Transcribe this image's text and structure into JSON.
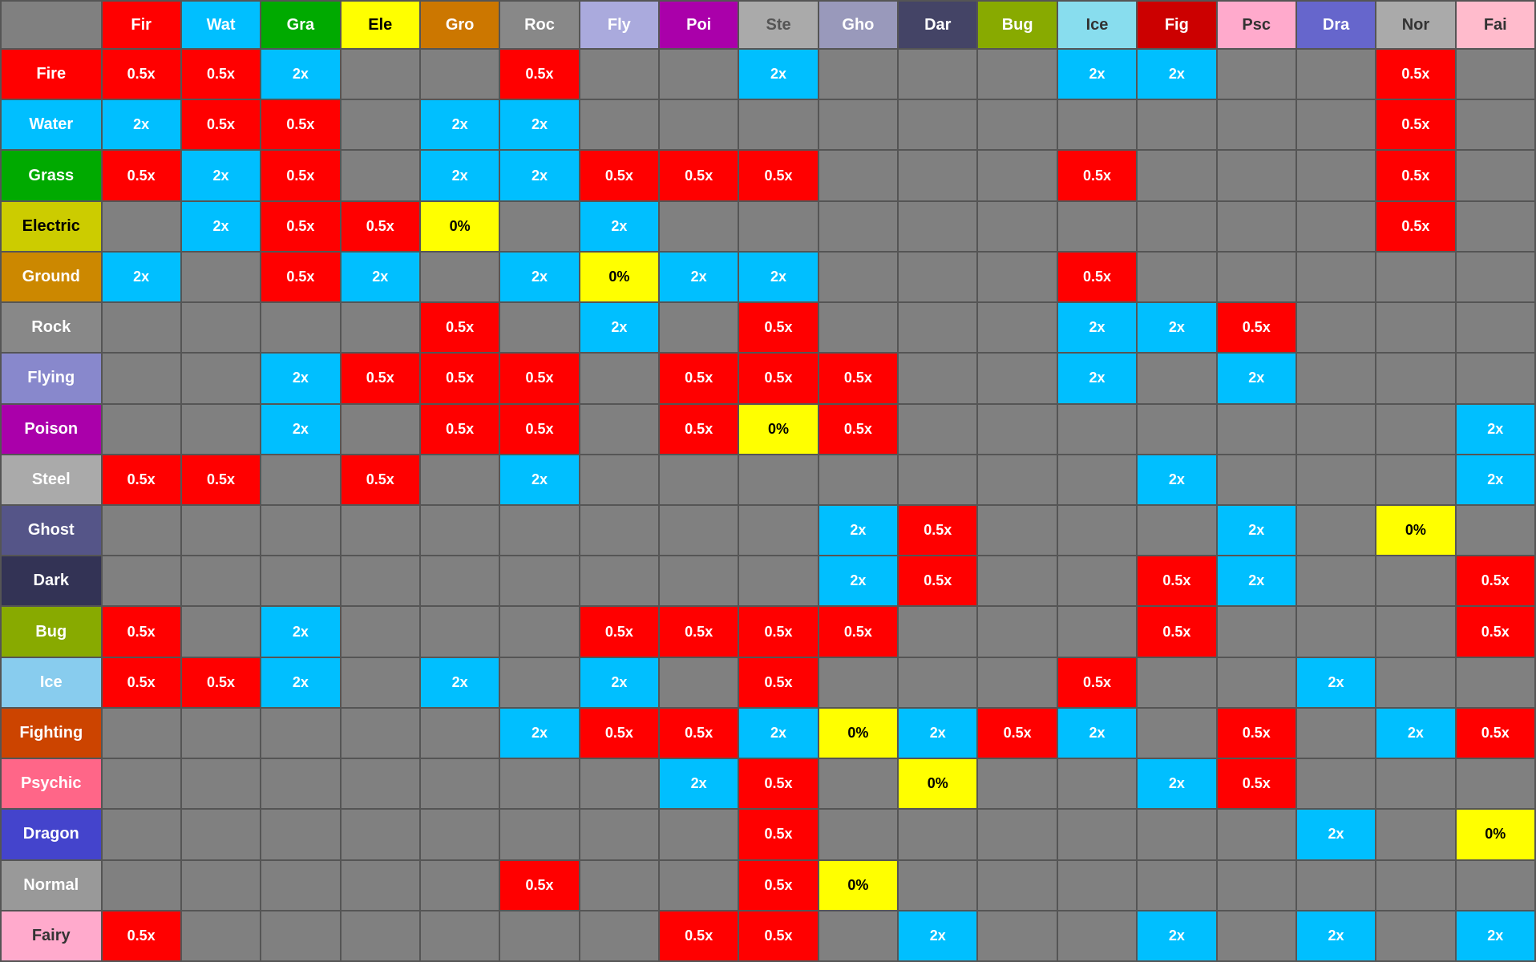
{
  "headers": {
    "corner": "",
    "cols": [
      {
        "label": "Fir",
        "class": "hdr-fir"
      },
      {
        "label": "Wat",
        "class": "hdr-wat"
      },
      {
        "label": "Gra",
        "class": "hdr-gra"
      },
      {
        "label": "Ele",
        "class": "hdr-ele"
      },
      {
        "label": "Gro",
        "class": "hdr-gro"
      },
      {
        "label": "Roc",
        "class": "hdr-roc"
      },
      {
        "label": "Fly",
        "class": "hdr-fly"
      },
      {
        "label": "Poi",
        "class": "hdr-poi"
      },
      {
        "label": "Ste",
        "class": "hdr-ste"
      },
      {
        "label": "Gho",
        "class": "hdr-gho"
      },
      {
        "label": "Dar",
        "class": "hdr-dar"
      },
      {
        "label": "Bug",
        "class": "hdr-bug"
      },
      {
        "label": "Ice",
        "class": "hdr-ice"
      },
      {
        "label": "Fig",
        "class": "hdr-fig"
      },
      {
        "label": "Psc",
        "class": "hdr-psc"
      },
      {
        "label": "Dra",
        "class": "hdr-dra"
      },
      {
        "label": "Nor",
        "class": "hdr-nor"
      },
      {
        "label": "Fai",
        "class": "hdr-fai"
      }
    ]
  },
  "rows": [
    {
      "label": "Fire",
      "labelClass": "label-fire",
      "textColor": "white",
      "cells": [
        "0.5x",
        "0.5x",
        "2x",
        "",
        "",
        "0.5x",
        "",
        "",
        "2x",
        "",
        "",
        "",
        "2x",
        "2x",
        "",
        "",
        "0.5x",
        ""
      ]
    },
    {
      "label": "Water",
      "labelClass": "label-water",
      "textColor": "white",
      "cells": [
        "2x",
        "0.5x",
        "0.5x",
        "",
        "2x",
        "2x",
        "",
        "",
        "",
        "",
        "",
        "",
        "",
        "",
        "",
        "",
        "0.5x",
        ""
      ]
    },
    {
      "label": "Grass",
      "labelClass": "label-grass",
      "textColor": "white",
      "cells": [
        "0.5x",
        "2x",
        "0.5x",
        "",
        "2x",
        "2x",
        "0.5x",
        "0.5x",
        "0.5x",
        "",
        "",
        "",
        "0.5x",
        "",
        "",
        "",
        "0.5x",
        ""
      ]
    },
    {
      "label": "Electric",
      "labelClass": "label-electric",
      "textColor": "black",
      "cells": [
        "",
        "2x",
        "0.5x",
        "0.5x",
        "0%",
        "",
        "2x",
        "",
        "",
        "",
        "",
        "",
        "",
        "",
        "",
        "",
        "0.5x",
        ""
      ]
    },
    {
      "label": "Ground",
      "labelClass": "label-ground",
      "textColor": "white",
      "cells": [
        "2x",
        "",
        "0.5x",
        "2x",
        "",
        "2x",
        "0%",
        "2x",
        "2x",
        "",
        "",
        "",
        "0.5x",
        "",
        "",
        "",
        "",
        ""
      ]
    },
    {
      "label": "Rock",
      "labelClass": "label-rock",
      "textColor": "white",
      "cells": [
        "",
        "",
        "",
        "",
        "0.5x",
        "",
        "2x",
        "",
        "0.5x",
        "",
        "",
        "",
        "2x",
        "2x",
        "0.5x",
        "",
        "",
        ""
      ]
    },
    {
      "label": "Flying",
      "labelClass": "label-flying",
      "textColor": "white",
      "cells": [
        "",
        "",
        "2x",
        "0.5x",
        "0.5x",
        "0.5x",
        "",
        "0.5x",
        "0.5x",
        "0.5x",
        "",
        "",
        "2x",
        "",
        "2x",
        "",
        "",
        ""
      ]
    },
    {
      "label": "Poison",
      "labelClass": "label-poison",
      "textColor": "white",
      "cells": [
        "",
        "",
        "2x",
        "",
        "0.5x",
        "0.5x",
        "",
        "0.5x",
        "0%",
        "0.5x",
        "",
        "",
        "",
        "",
        "",
        "",
        "",
        "2x"
      ]
    },
    {
      "label": "Steel",
      "labelClass": "label-steel",
      "textColor": "white",
      "cells": [
        "0.5x",
        "0.5x",
        "",
        "0.5x",
        "",
        "2x",
        "",
        "",
        "",
        "",
        "",
        "",
        "",
        "2x",
        "",
        "",
        "",
        "2x"
      ]
    },
    {
      "label": "Ghost",
      "labelClass": "label-ghost",
      "textColor": "white",
      "cells": [
        "",
        "",
        "",
        "",
        "",
        "",
        "",
        "",
        "",
        "2x",
        "0.5x",
        "",
        "",
        "",
        "2x",
        "",
        "0%",
        ""
      ]
    },
    {
      "label": "Dark",
      "labelClass": "label-dark",
      "textColor": "white",
      "cells": [
        "",
        "",
        "",
        "",
        "",
        "",
        "",
        "",
        "",
        "2x",
        "0.5x",
        "",
        "",
        "0.5x",
        "2x",
        "",
        "",
        "0.5x"
      ]
    },
    {
      "label": "Bug",
      "labelClass": "label-bug",
      "textColor": "white",
      "cells": [
        "0.5x",
        "",
        "2x",
        "",
        "",
        "",
        "0.5x",
        "0.5x",
        "0.5x",
        "0.5x",
        "",
        "",
        "",
        "0.5x",
        "",
        "",
        "",
        "0.5x"
      ]
    },
    {
      "label": "Ice",
      "labelClass": "label-ice",
      "textColor": "white",
      "cells": [
        "0.5x",
        "0.5x",
        "2x",
        "",
        "2x",
        "",
        "2x",
        "",
        "0.5x",
        "",
        "",
        "",
        "0.5x",
        "",
        "",
        "2x",
        "",
        ""
      ]
    },
    {
      "label": "Fighting",
      "labelClass": "label-fighting",
      "textColor": "white",
      "cells": [
        "",
        "",
        "",
        "",
        "",
        "2x",
        "0.5x",
        "0.5x",
        "2x",
        "0%",
        "2x",
        "0.5x",
        "2x",
        "",
        "0.5x",
        "",
        "2x",
        "0.5x"
      ]
    },
    {
      "label": "Psychic",
      "labelClass": "label-psychic",
      "textColor": "white",
      "cells": [
        "",
        "",
        "",
        "",
        "",
        "",
        "",
        "2x",
        "0.5x",
        "",
        "0%",
        "",
        "",
        "2x",
        "0.5x",
        "",
        "",
        ""
      ]
    },
    {
      "label": "Dragon",
      "labelClass": "label-dragon",
      "textColor": "white",
      "cells": [
        "",
        "",
        "",
        "",
        "",
        "",
        "",
        "",
        "0.5x",
        "",
        "",
        "",
        "",
        "",
        "",
        "2x",
        "",
        "0%"
      ]
    },
    {
      "label": "Normal",
      "labelClass": "label-normal",
      "textColor": "white",
      "cells": [
        "",
        "",
        "",
        "",
        "",
        "0.5x",
        "",
        "",
        "0.5x",
        "0%",
        "",
        "",
        "",
        "",
        "",
        "",
        "",
        ""
      ]
    },
    {
      "label": "Fairy",
      "labelClass": "label-fairy",
      "textColor": "#333",
      "cells": [
        "0.5x",
        "",
        "",
        "",
        "",
        "",
        "",
        "0.5x",
        "0.5x",
        "",
        "2x",
        "",
        "",
        "2x",
        "",
        "2x",
        "",
        "2x"
      ]
    }
  ],
  "cellColors": {
    "0.5x": "red",
    "2x": "blue",
    "0%": "yellow",
    "": "gray"
  }
}
